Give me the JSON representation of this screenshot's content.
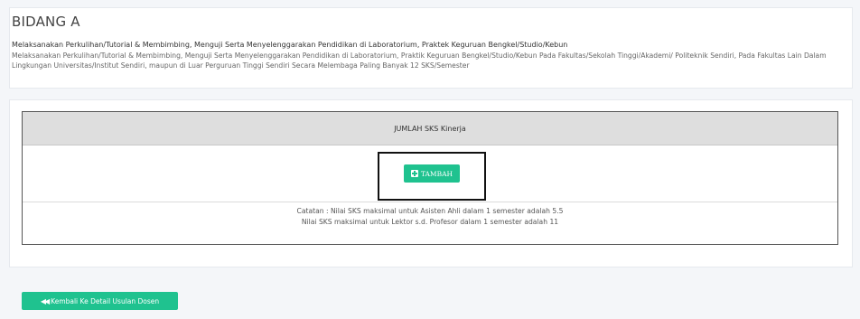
{
  "section": {
    "title": "BIDANG A",
    "subtitle": "Melaksanakan Perkulihan/Tutorial & Membimbing, Menguji Serta Menyelenggarakan Pendidikan di Laboratorium, Praktek Keguruan Bengkel/Studio/Kebun",
    "description": "Melaksanakan Perkulihan/Tutorial & Membimbing, Menguji Serta Menyelenggarakan Pendidikan di Laboratorium, Praktik Keguruan Bengkel/Studio/Kebun Pada Fakultas/Sekolah Tinggi/Akademi/ Politeknik Sendiri, Pada Fakultas Lain Dalam Lingkungan Universitas/Institut Sendiri, maupun di Luar Perguruan Tinggi Sendiri Secara Melembaga Paling Banyak 12 SKS/Semester"
  },
  "table": {
    "header": "JUMLAH SKS Kinerja",
    "add_button": {
      "label": "TAMBAH",
      "icon": "plus-square-icon"
    },
    "notes": [
      "Catatan : Nilai SKS maksimal untuk Asisten Ahli dalam 1 semester adalah 5.5",
      "Nilai SKS maksimal untuk Lektor s.d. Profesor dalam 1 semester adalah 11"
    ]
  },
  "footer": {
    "back_button": {
      "label": "Kembali Ke Detail Usulan Dosen",
      "icon": "double-left-icon"
    }
  },
  "colors": {
    "accent": "#1fc28f",
    "background": "#f4f6f9",
    "header_bg": "#dedede"
  }
}
